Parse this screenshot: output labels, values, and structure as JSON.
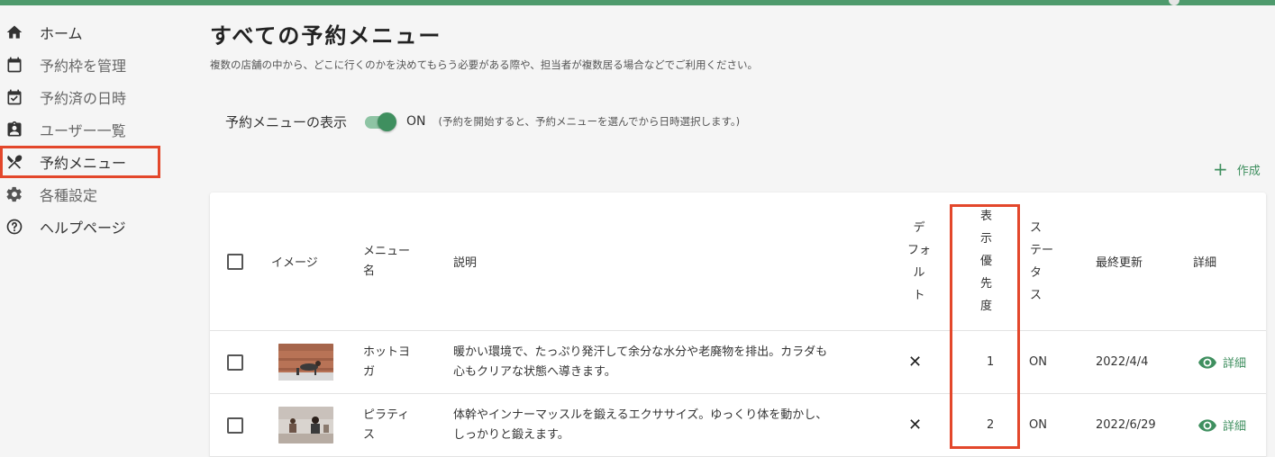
{
  "sidebar": {
    "items": [
      {
        "label": "ホーム"
      },
      {
        "label": "予約枠を管理"
      },
      {
        "label": "予約済の日時"
      },
      {
        "label": "ユーザー一覧"
      },
      {
        "label": "予約メニュー"
      },
      {
        "label": "各種設定"
      },
      {
        "label": "ヘルプページ"
      }
    ]
  },
  "page": {
    "title": "すべての予約メニュー",
    "description": "複数の店舗の中から、どこに行くのかを決めてもらう必要がある際や、担当者が複数居る場合などでご利用ください。"
  },
  "toggle": {
    "label": "予約メニューの表示",
    "state": "ON",
    "note": "(予約を開始すると、予約メニューを選んでから日時選択します。)"
  },
  "actions": {
    "create_label": "作成"
  },
  "table": {
    "headers": {
      "image": "イメージ",
      "menu_name_1": "メニュー",
      "menu_name_2": "名",
      "description": "説明",
      "default_chars": [
        "デ",
        "フォ",
        "ル",
        "ト"
      ],
      "priority_chars": [
        "表",
        "示",
        "優",
        "先",
        "度"
      ],
      "status_chars": [
        "ス",
        "テー",
        "タ",
        "ス"
      ],
      "updated": "最終更新",
      "detail": "詳細"
    },
    "rows": [
      {
        "name_line1": "ホットヨ",
        "name_line2": "ガ",
        "desc_line1": "暖かい環境で、たっぷり発汗して余分な水分や老廃物を排出。カラダも",
        "desc_line2": "心もクリアな状態へ導きます。",
        "default": "✕",
        "priority": "1",
        "status": "ON",
        "updated": "2022/4/4",
        "detail": "詳細"
      },
      {
        "name_line1": "ピラティ",
        "name_line2": "ス",
        "desc_line1": "体幹やインナーマッスルを鍛えるエクササイズ。ゆっくり体を動かし、",
        "desc_line2": "しっかりと鍛えます。",
        "default": "✕",
        "priority": "2",
        "status": "ON",
        "updated": "2022/6/29",
        "detail": "詳細"
      }
    ]
  },
  "colors": {
    "brand_green": "#3f8f5f",
    "highlight_red": "#e3472b",
    "topbar": "#4e9a6c"
  }
}
